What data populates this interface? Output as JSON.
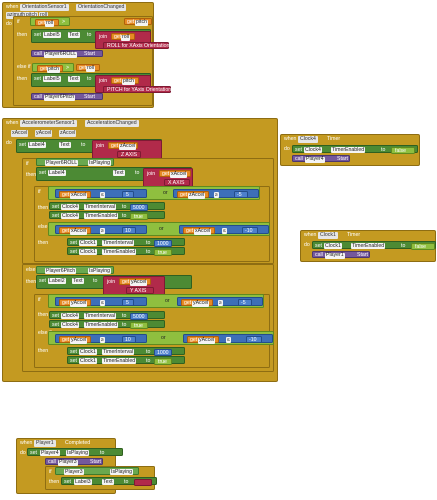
{
  "blocks": {
    "orient": {
      "when": "when",
      "component": "OrientationSensor1",
      "event": "OrientationChanged",
      "params": [
        "azimuth",
        "pitch",
        "roll"
      ],
      "do": "do",
      "if": "if",
      "then": "then",
      "else_if": "else if",
      "get": "get",
      "roll": "roll",
      "pitch": "pitch",
      "gt": ">",
      "zero": "0",
      "set": "set",
      "label5": "Label5",
      "text_prop": "Text",
      "to": "to",
      "join": "join",
      "roll_text": "ROLL for XAxis Orientation",
      "call": "call",
      "player_roll_start": "Player6ROLL",
      "start": "Start",
      "lt": "<",
      "pitch_text": "PITCH for YAxis Orientation",
      "player_pitch_start": "Player6Pitch"
    },
    "accel": {
      "when": "when",
      "component": "AccelerometerSensor1",
      "event": "AccelerationChanged",
      "params": [
        "xAccel",
        "yAccel",
        "zAccel"
      ],
      "do": "do",
      "set": "set",
      "label4": "Label4",
      "text_prop": "Text",
      "to": "to",
      "join": "join",
      "get": "get",
      "xaccel": "xAccel",
      "yaccel": "yAccel",
      "zaxis": "Z AXIS",
      "if": "if",
      "then": "then",
      "else_if": "else if",
      "player_roll": "Player6ROLL",
      "is_playing": "IsPlaying",
      "label4b": "Label4",
      "xaxis": "X AXIS",
      "lte": "≤",
      "gte": "≥",
      "or": "or",
      "val5": "5",
      "neg5": "-5",
      "val10": "10",
      "neg10": "-10",
      "clock4": "Clock4",
      "clock1": "Clock1",
      "timer_interval": "TimerInterval",
      "timer_enabled": "TimerEnabled",
      "val5000": "5000",
      "val1000": "1000",
      "true_val": "true",
      "player_pitch": "Player6Pitch",
      "label2": "Label2",
      "yaxis": "Y AXIS"
    },
    "clock4_timer": {
      "when": "when",
      "component": "Clock4",
      "event": "Timer",
      "do": "do",
      "set": "set",
      "clock": "Clock4",
      "prop": "TimerEnabled",
      "to": "to",
      "false_val": "false",
      "call": "call",
      "player": "Player4",
      "start": "Start"
    },
    "clock1_timer": {
      "when": "when",
      "component": "Clock1",
      "event": "Timer",
      "do": "do",
      "set": "set",
      "clock": "Clock1",
      "prop": "TimerEnabled",
      "to": "to",
      "false_val": "false",
      "call": "call",
      "player": "Player1",
      "start": "Start"
    },
    "player1_completed": {
      "when": "when",
      "component": "Player1",
      "event": "Completed",
      "do": "do",
      "set": "set",
      "player4": "Player4",
      "is_playing": "IsPlaying",
      "to": "to",
      "call": "call",
      "player3": "Player3",
      "start": "Start",
      "if": "if",
      "then": "then",
      "label3": "Label3",
      "text_prop": "Text",
      "empty_text": " "
    }
  },
  "colors": {
    "event": "#c49a21",
    "set": "#4c8a34",
    "call": "#74589c",
    "math": "#3d6fb8",
    "text": "#b12a4a",
    "get": "#e68a24",
    "logic": "#8fbf3f"
  }
}
